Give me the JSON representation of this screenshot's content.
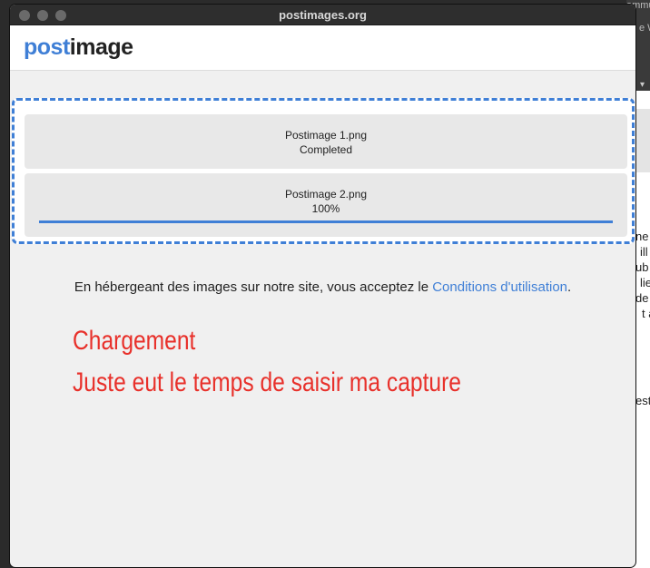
{
  "window": {
    "title": "postimages.org"
  },
  "logo": {
    "part1": "post",
    "part2": "image"
  },
  "uploads": [
    {
      "name": "Postimage 1.png",
      "status": "Completed"
    },
    {
      "name": "Postimage 2.png",
      "status": "100%",
      "progress_percent": 100
    }
  ],
  "terms": {
    "text": "En hébergeant des images sur notre site, vous acceptez le ",
    "link": "Conditions d'utilisation",
    "end": "."
  },
  "annotation": {
    "line1": "Chargement",
    "line2": "Juste eut le temps de saisir ma capture"
  },
  "background_fragments": {
    "top_a": "ammu",
    "top_b": "e W",
    "f1": "ne",
    "f2": "ill",
    "f3": "ub",
    "f4": "lie",
    "f5": "de",
    "f6": "t a",
    "f7": "est"
  },
  "colors": {
    "accent": "#3f7fd6",
    "annotation": "#e8302a"
  }
}
